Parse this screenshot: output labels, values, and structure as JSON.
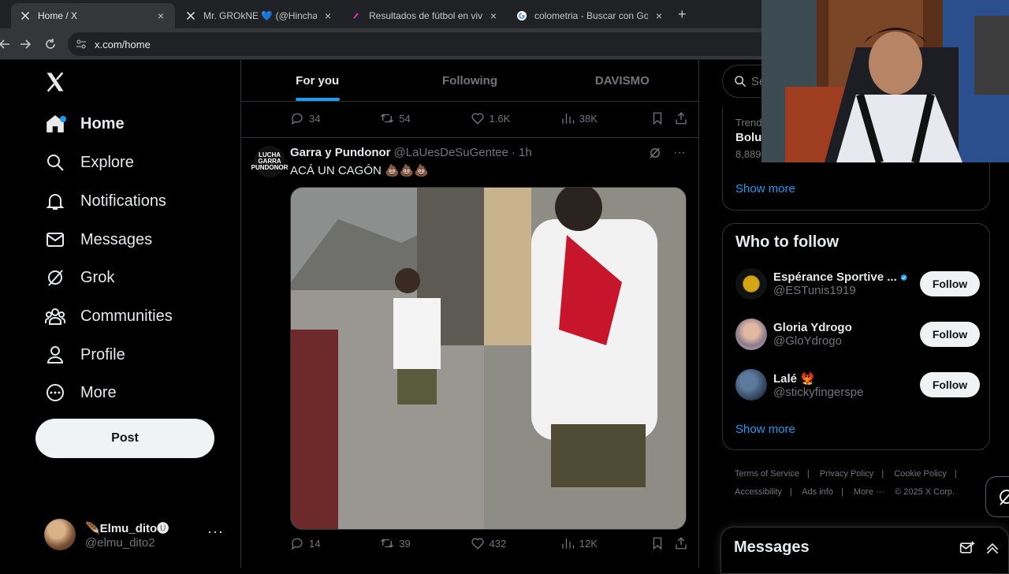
{
  "browser": {
    "tabs": [
      {
        "title": "Home / X",
        "icon": "x-logo-icon",
        "active": true
      },
      {
        "title": "Mr. GROkNE 💙 (@HinchaGron",
        "icon": "x-logo-icon",
        "active": false
      },
      {
        "title": "Resultados de fútbol en vivo, M",
        "icon": "flashscore-icon",
        "active": false
      },
      {
        "title": "colometria - Buscar con Google",
        "icon": "google-icon",
        "active": false
      }
    ],
    "close_glyph": "×",
    "new_tab_glyph": "+",
    "url": "x.com/home"
  },
  "sidebar": {
    "items": [
      {
        "label": "Home",
        "icon": "home-icon"
      },
      {
        "label": "Explore",
        "icon": "search-icon"
      },
      {
        "label": "Notifications",
        "icon": "bell-icon"
      },
      {
        "label": "Messages",
        "icon": "envelope-icon"
      },
      {
        "label": "Grok",
        "icon": "grok-icon"
      },
      {
        "label": "Communities",
        "icon": "people-icon"
      },
      {
        "label": "Profile",
        "icon": "person-icon"
      },
      {
        "label": "More",
        "icon": "more-circle-icon"
      }
    ],
    "post_label": "Post",
    "account": {
      "name": "🪶Elmu_dito🅤",
      "handle": "@elmu_dito2"
    }
  },
  "timeline": {
    "tabs": [
      "For you",
      "Following",
      "DAVISMO"
    ],
    "prev_post_stats": {
      "replies": "34",
      "reposts": "54",
      "likes": "1.6K",
      "views": "38K"
    },
    "post": {
      "author_name": "Garra y Pundonor",
      "handle": "@LaUesDeSuGentee",
      "time": "· 1h",
      "avatar_text": "LUCHA GARRA PUNDONOR",
      "text": "ACÁ UN CAGÓN 💩💩💩",
      "stats": {
        "replies": "14",
        "reposts": "39",
        "likes": "432",
        "views": "12K"
      }
    }
  },
  "right": {
    "search_placeholder": "Se",
    "trend": {
      "meta": "Trend",
      "name": "Bolu",
      "count": "8,889"
    },
    "trends_show_more": "Show more",
    "who_to_follow_title": "Who to follow",
    "who_to_follow": [
      {
        "name": "Espérance Sportive ...",
        "handle": "@ESTunis1919",
        "verified": true,
        "follow_label": "Follow"
      },
      {
        "name": "Gloria Ydrogo",
        "handle": "@GloYdrogo",
        "verified": false,
        "follow_label": "Follow"
      },
      {
        "name": "Lalé 🐦‍🔥",
        "handle": "@stickyfingerspe",
        "verified": false,
        "follow_label": "Follow"
      }
    ],
    "wtf_show_more": "Show more",
    "footer": [
      "Terms of Service",
      "|",
      "Privacy Policy",
      "|",
      "Cookie Policy",
      "|",
      "Accessibility",
      "|",
      "Ads info",
      "|",
      "More ···",
      "© 2025 X Corp."
    ],
    "messages_title": "Messages"
  },
  "colors": {
    "accent": "#1d9bf0",
    "bg": "#000000",
    "border": "#2f3336",
    "muted": "#71767b"
  }
}
